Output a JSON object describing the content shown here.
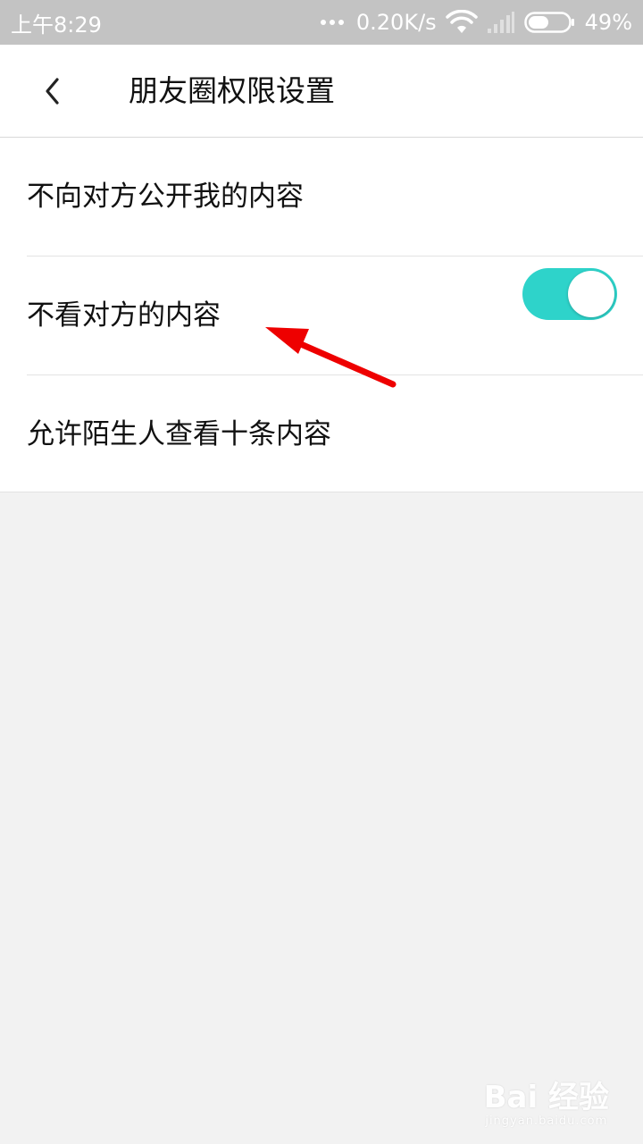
{
  "status_bar": {
    "time": "上午8:29",
    "network_speed": "0.20K/s",
    "battery_percent": "49%",
    "battery_level": 0.49
  },
  "header": {
    "title": "朋友圈权限设置"
  },
  "settings": {
    "items": [
      {
        "label": "不向对方公开我的内容"
      },
      {
        "label": "不看对方的内容"
      },
      {
        "label": "允许陌生人查看十条内容",
        "toggle_on": true
      }
    ]
  },
  "colors": {
    "status_bar_bg": "#c3c3c3",
    "toggle_on": "#2ed3ca",
    "annotation": "#ee0000",
    "page_bg": "#f2f2f2"
  },
  "icons": {
    "back": "chevron-left-icon",
    "wifi": "wifi-icon",
    "signal": "signal-icon",
    "battery": "battery-icon",
    "more": "more-dots-icon"
  },
  "watermark": {
    "logo": "Bai 经验",
    "url": "jingyan.baidu.com"
  }
}
